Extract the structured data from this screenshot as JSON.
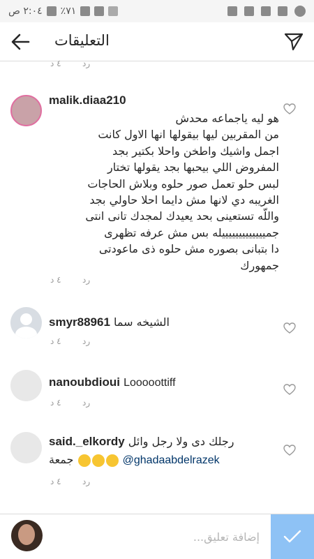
{
  "statusbar": {
    "time": "٢:٠٤ ص",
    "battery": "٪٧١"
  },
  "header": {
    "title": "التعليقات"
  },
  "top_meta": {
    "reply": "رد",
    "time": "٤ د"
  },
  "comments": [
    {
      "username": "malik.diaa210",
      "lines": [
        "هو ليه ياجماعه محدش",
        "من المقربين ليها بيقولها انها الاول كانت",
        "اجمل واشيك واطخن واحلا بكتير بجد",
        "المفروض اللي بيحبها بجد يقولها تختار",
        "لبس حلو تعمل صور حلوه وبلاش الحاجات",
        "الغريبه دي لانها مش دايما احلا حاولي بجد",
        "واللّه تستعينى بحد يعيدك لمجدك تانى انتى",
        "جميييييييييييييله بس مش عرفه تظهرى",
        "دا بتبانى بصوره مش حلوه ذى ماعودتى",
        "جمهورك"
      ],
      "reply": "رد",
      "time": "٤ د",
      "avatar_color": "#c9a2a8"
    },
    {
      "username": "smyr88961",
      "text": "الشيخه سما",
      "reply": "رد",
      "time": "٤ د",
      "avatar_color": "#d8dde3"
    },
    {
      "username": "nanoubdioui",
      "text": "Looooottiff",
      "reply": "رد",
      "time": "٤ د",
      "avatar_color": "#e8e8e8"
    },
    {
      "username": "said._elkordy",
      "text": "رجلك دى ولا رجل وائل",
      "mention": "@ghadaabdelrazek",
      "tail": "جمعة",
      "reply": "رد",
      "time": "٤ د",
      "avatar_color": "#e8e8e8"
    }
  ],
  "composer": {
    "placeholder": "إضافة تعليق..."
  },
  "colors": {
    "accent": "#8ec2f5",
    "link": "#003569",
    "muted": "#999999"
  }
}
